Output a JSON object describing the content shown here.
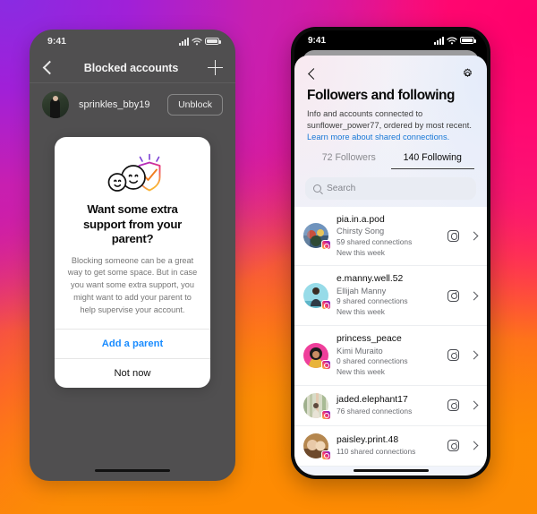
{
  "left_phone": {
    "status_bar": {
      "time": "9:41",
      "signal_icon": "cellular-bars-icon",
      "wifi_icon": "wifi-icon",
      "battery_icon": "battery-icon"
    },
    "nav": {
      "back_icon": "chevron-left-icon",
      "title": "Blocked accounts",
      "add_icon": "plus-icon"
    },
    "blocked_row": {
      "avatar": "user-avatar",
      "username": "sprinkles_bby19",
      "action_label": "Unblock"
    },
    "modal": {
      "illustration": "parental-supervision-shield-illustration",
      "heading": "Want some extra support from your parent?",
      "body": "Blocking someone can be a great way to get some space. But in case you want some extra support, you might want to add your parent to help supervise your account.",
      "primary_label": "Add a parent",
      "secondary_label": "Not now"
    }
  },
  "right_phone": {
    "status_bar": {
      "time": "9:41",
      "signal_icon": "cellular-bars-icon",
      "wifi_icon": "wifi-icon",
      "battery_icon": "battery-icon"
    },
    "nav": {
      "back_icon": "chevron-left-icon",
      "settings_icon": "gear-icon"
    },
    "title": "Followers and following",
    "subtitle": "Info and accounts connected to sunflower_power77, ordered by most recent.",
    "link": "Learn more about shared connections.",
    "tabs": [
      {
        "label": "72 Followers",
        "active": false
      },
      {
        "label": "140 Following",
        "active": true
      }
    ],
    "search": {
      "placeholder": "Search",
      "icon": "search-icon"
    },
    "list": [
      {
        "username": "pia.in.a.pod",
        "fullname": "Chirsty Song",
        "shared": "59 shared connections",
        "recency": "New this week",
        "avatar_colors": [
          "#7a9ec6",
          "#2b3d55"
        ]
      },
      {
        "username": "e.manny.well.52",
        "fullname": "Ellijah Manny",
        "shared": "9 shared connections",
        "recency": "New this week",
        "avatar_colors": [
          "#8ed8e8",
          "#3f7f93"
        ]
      },
      {
        "username": "princess_peace",
        "fullname": "Kimi Muraito",
        "shared": "0 shared connections",
        "recency": "New this week",
        "avatar_colors": [
          "#f0409a",
          "#c0166f"
        ]
      },
      {
        "username": "jaded.elephant17",
        "fullname": "",
        "shared": "76 shared connections",
        "recency": "",
        "avatar_colors": [
          "#cfd6c2",
          "#8fa184"
        ]
      },
      {
        "username": "paisley.print.48",
        "fullname": "",
        "shared": "110 shared connections",
        "recency": "",
        "avatar_colors": [
          "#c89a6a",
          "#7d5433"
        ]
      }
    ],
    "row_icons": {
      "instagram_icon": "instagram-icon",
      "chevron_icon": "chevron-right-icon"
    }
  },
  "colors": {
    "link_blue": "#1878d6",
    "cta_blue": "#1a8cff",
    "instagram_gradient_start": "#f9ce34",
    "instagram_gradient_mid": "#ee2a7b",
    "instagram_gradient_end": "#6228d7"
  }
}
